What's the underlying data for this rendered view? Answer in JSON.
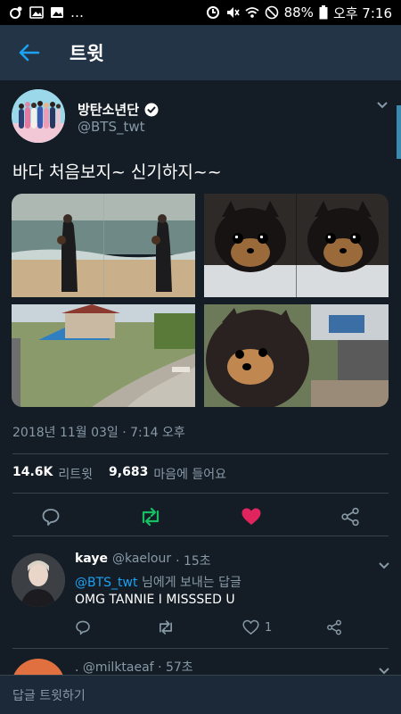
{
  "status_bar": {
    "left_ellipsis": "…",
    "battery": "88%",
    "time": "오후 7:16"
  },
  "header": {
    "title": "트윗"
  },
  "tweet": {
    "author_name": "방탄소년단",
    "author_handle": "@BTS_twt",
    "text": "바다 처음보지~ 신기하지~~",
    "timestamp": "2018년 11월 03일 · 7:14 오후",
    "retweets": "14.6K",
    "retweets_label": "리트윗",
    "likes": "9,683",
    "likes_label": "마음에 들어요",
    "accent_like": "#e0245e",
    "accent_retweet": "#17bf63"
  },
  "reply": {
    "name": "kaye",
    "handle": "@kaelour",
    "time": "· 15초",
    "mention": "@BTS_twt",
    "reply_to_suffix": "님에게 보내는 답글",
    "text": "OMG TANNIE I MISSSED U",
    "like_count": "1"
  },
  "reply2": {
    "partial": ". @milktaeaf · 57초"
  },
  "compose": {
    "placeholder": "답글 트윗하기"
  },
  "colors": {
    "background": "#141d26",
    "header": "#243447",
    "link": "#1da1f2",
    "muted": "#8899a6"
  }
}
